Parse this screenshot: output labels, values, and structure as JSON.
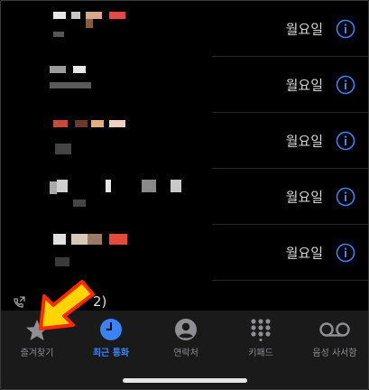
{
  "recents": {
    "items": [
      {
        "day": "월요일"
      },
      {
        "day": "월요일"
      },
      {
        "day": "월요일"
      },
      {
        "day": "월요일"
      },
      {
        "day": "월요일"
      }
    ],
    "partial_glyph": "2)"
  },
  "tabbar": {
    "favorites": "즐겨찾기",
    "recents": "최근 통화",
    "contacts": "연락처",
    "keypad": "키패드",
    "voicemail": "음성 사서함"
  },
  "colors": {
    "accent": "#3b82f6",
    "arrow_red": "#ff2a00",
    "arrow_yellow": "#ffd400"
  }
}
